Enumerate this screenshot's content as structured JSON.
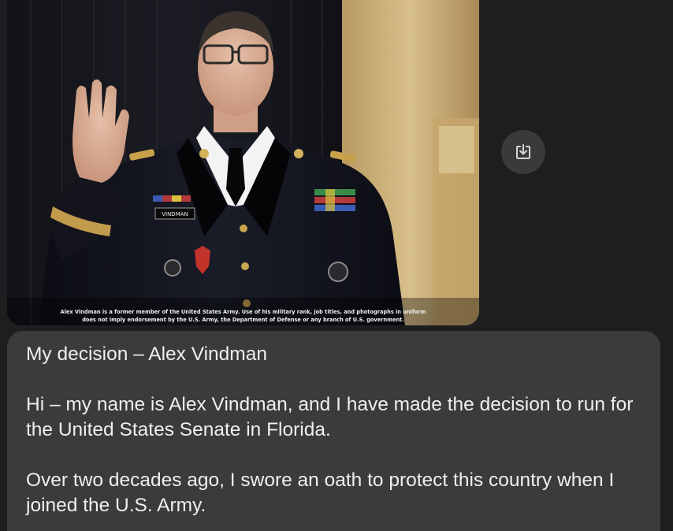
{
  "attachment": {
    "caption_line1": "Alex Vindman is a former member of the United States Army. Use of his military rank, job titles, and photographs in uniform",
    "caption_line2": "does not imply endorsement by the U.S. Army, the Department of Defense or any branch of U.S. government.",
    "name_tag": "VINDMAN"
  },
  "actions": {
    "save_icon": "download-icon"
  },
  "message": {
    "title": "My decision – Alex Vindman",
    "paragraph1": "Hi – my name is Alex Vindman, and I have made the decision to run for the United States Senate in Florida.",
    "paragraph2": "Over two decades ago, I swore an oath to protect this country when I joined the U.S. Army."
  },
  "colors": {
    "background": "#1e1e20",
    "bubble": "#3b3b3e",
    "button": "#3a3a3d",
    "text": "#efeff1"
  }
}
